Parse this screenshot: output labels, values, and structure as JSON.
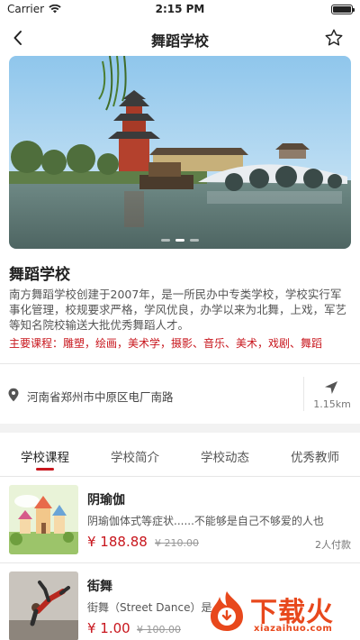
{
  "status_bar": {
    "carrier": "Carrier",
    "time": "2:15 PM",
    "battery_level": 1.0
  },
  "nav": {
    "title": "舞蹈学校"
  },
  "banner": {
    "image": "school-pavilion-lake-bridge",
    "slide_count": 3,
    "active_slide": 2
  },
  "school": {
    "name": "舞蹈学校",
    "description": "南方舞蹈学校创建于2007年，是一所民办中专类学校，学校实行军事化管理，校规要求严格，学风优良，办学以来为北舞，上戏，军艺等知名院校输送大批优秀舞蹈人才。",
    "courses_line": "主要课程：雕塑，绘画，美术学，摄影、音乐、美术，戏剧、舞蹈"
  },
  "location": {
    "address": "河南省郑州市中原区电厂南路",
    "distance": "1.15km"
  },
  "tabs": [
    {
      "label": "学校课程",
      "active": true
    },
    {
      "label": "学校简介",
      "active": false
    },
    {
      "label": "学校动态",
      "active": false
    },
    {
      "label": "优秀教师",
      "active": false
    }
  ],
  "courses": [
    {
      "name": "阴瑜伽",
      "desc": "阴瑜伽体式等症状......不能够是自己不够爱的人也",
      "price": "¥ 188.88",
      "original_price": "¥ 210.00",
      "paid": "2人付款",
      "thumb": "cartoon-castle-illustration"
    },
    {
      "name": "街舞",
      "desc": "街舞（Street Dance）是",
      "price": "¥ 1.00",
      "original_price": "¥ 100.00",
      "paid": "",
      "thumb": "street-dancer-photo"
    }
  ],
  "watermark": {
    "text": "下载火",
    "url": "xiazaihuo.com"
  },
  "colors": {
    "accent": "#c8161d",
    "watermark": "#e8481c"
  }
}
